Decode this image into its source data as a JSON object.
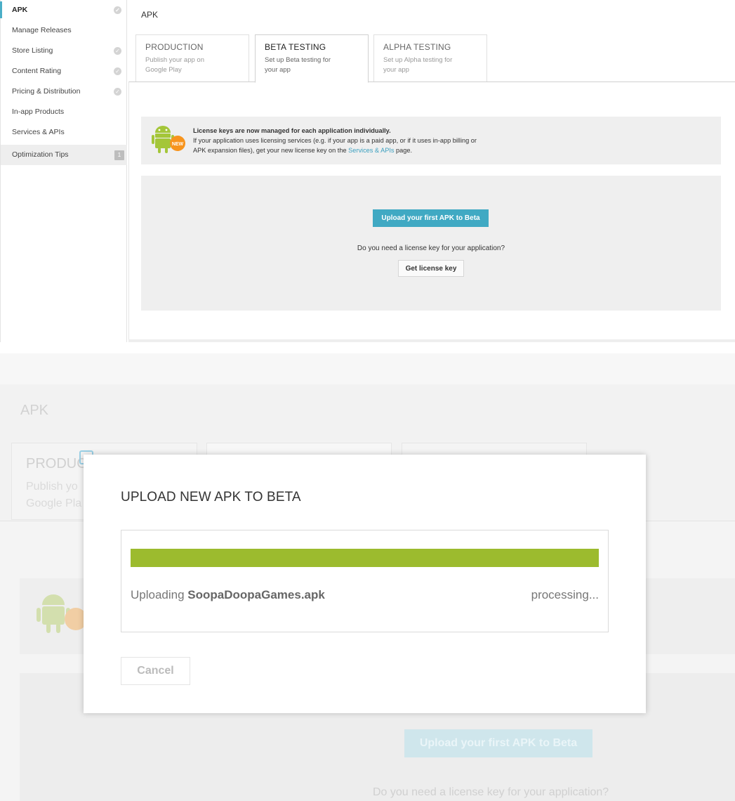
{
  "sidebar": {
    "items": [
      {
        "label": "APK",
        "check": true,
        "active": true
      },
      {
        "label": "Manage Releases",
        "check": false
      },
      {
        "label": "Store Listing",
        "check": true
      },
      {
        "label": "Content Rating",
        "check": true
      },
      {
        "label": "Pricing & Distribution",
        "check": true
      },
      {
        "label": "In-app Products",
        "check": false
      },
      {
        "label": "Services & APIs",
        "check": false
      }
    ],
    "optimization": {
      "label": "Optimization Tips",
      "count": "1"
    },
    "check_glyph": "✓"
  },
  "main": {
    "title": "APK",
    "tabs": [
      {
        "label": "PRODUCTION",
        "desc": "Publish your app on Google Play"
      },
      {
        "label": "BETA TESTING",
        "desc": "Set up Beta testing for your app"
      },
      {
        "label": "ALPHA TESTING",
        "desc": "Set up Alpha testing for your app"
      }
    ],
    "notice": {
      "heading": "License keys are now managed for each application individually.",
      "line1": "If your application uses licensing services (e.g. if your app is a paid app, or if it uses in-app billing or",
      "line2_before": "APK expansion files), get your new license key on the ",
      "link": "Services & APIs",
      "line2_after": " page.",
      "badge": "NEW"
    },
    "upload_button": "Upload your first APK to Beta",
    "license_question": "Do you need a license key for your application?",
    "license_button": "Get license key"
  },
  "dimmed": {
    "title": "APK",
    "tab_label": "PRODUC",
    "tab_desc_1": "Publish yo",
    "tab_desc_2": "Google Pla",
    "upload_button": "Upload your first APK to Beta",
    "license_question": "Do you need a license key for your application?"
  },
  "modal": {
    "title": "UPLOAD NEW APK TO BETA",
    "progress_percent": 100,
    "uploading_prefix": "Uploading ",
    "file_name": "SoopaDoopaGames.apk",
    "status": "processing...",
    "cancel": "Cancel"
  },
  "colors": {
    "accent": "#40a9c3",
    "progress": "#9cbb2e",
    "android": "#a4c639",
    "badge": "#f7941d"
  }
}
